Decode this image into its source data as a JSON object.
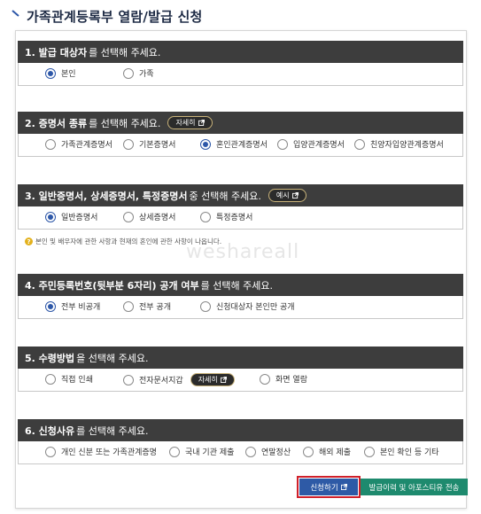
{
  "page": {
    "title": "가족관계등록부 열람/발급 신청",
    "watermark": "weshareall"
  },
  "sections": [
    {
      "bold": "1. 발급 대상자",
      "rest": "를 선택해 주세요.",
      "options": [
        "본인",
        "가족"
      ],
      "selected": 0
    },
    {
      "bold": "2. 증명서 종류",
      "rest": "를 선택해 주세요.",
      "pill": "자세히",
      "options": [
        "가족관계증명서",
        "기본증명서",
        "혼인관계증명서",
        "입양관계증명서",
        "친양자입양관계증명서"
      ],
      "selected": 2
    },
    {
      "bold": "3. 일반증명서, 상세증명서, 특정증명서",
      "rest": " 중 선택해 주세요.",
      "pill": "예시",
      "options": [
        "일반증명서",
        "상세증명서",
        "특정증명서"
      ],
      "selected": 0
    },
    {
      "bold": "4. 주민등록번호(뒷부분 6자리) 공개 여부",
      "rest": "를 선택해 주세요.",
      "options": [
        "전부 비공개",
        "전부 공개",
        "신청대상자 본인만 공개"
      ],
      "selected": 0
    },
    {
      "bold": "5. 수령방법",
      "rest": "을 선택해 주세요.",
      "options": [
        "직접 인쇄",
        "전자문서지갑",
        "화면 열람"
      ],
      "inline_pill": "자세히",
      "selected": -1
    },
    {
      "bold": "6. 신청사유",
      "rest": "를 선택해 주세요.",
      "options": [
        "개인 신분 또는 가족관계증명",
        "국내 기관 제출",
        "연말정산",
        "해외 제출",
        "본인 확인 등 기타"
      ],
      "selected": -1
    }
  ],
  "note": "본인 및 배우자에 관한 사항과 현재의 혼인에 관한 사항이 나옵니다.",
  "buttons": {
    "apply": "신청하기",
    "history": "발급이력 및 아포스티유 전송"
  }
}
